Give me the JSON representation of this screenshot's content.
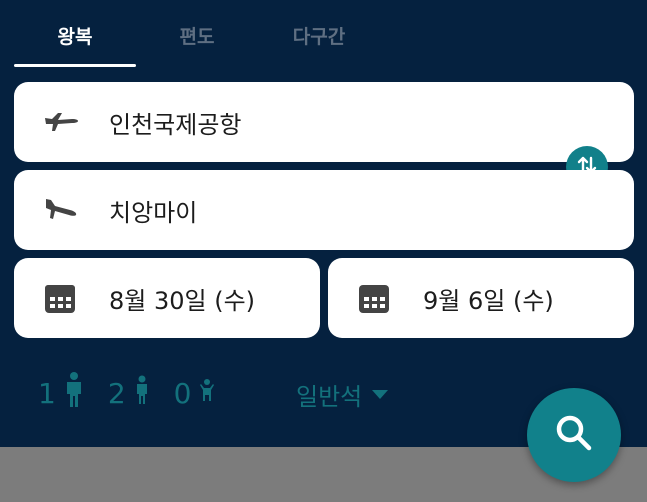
{
  "tabs": [
    {
      "label": "왕복",
      "active": true
    },
    {
      "label": "편도",
      "active": false
    },
    {
      "label": "다구간",
      "active": false
    }
  ],
  "origin": {
    "label": "인천국제공항",
    "icon": "takeoff-icon"
  },
  "destination": {
    "label": "치앙마이",
    "icon": "landing-icon"
  },
  "swap_icon": "swap-vertical-icon",
  "dates": {
    "depart": {
      "label": "8월 30일 (수)",
      "icon": "calendar-icon"
    },
    "return": {
      "label": "9월 6일 (수)",
      "icon": "calendar-icon"
    }
  },
  "passengers": {
    "adults": "1",
    "children": "2",
    "infants": "0"
  },
  "cabin": {
    "label": "일반석"
  },
  "search_icon": "search-icon",
  "colors": {
    "background": "#05213f",
    "accent": "#11818b",
    "inactive_tab": "#5f6f82"
  }
}
